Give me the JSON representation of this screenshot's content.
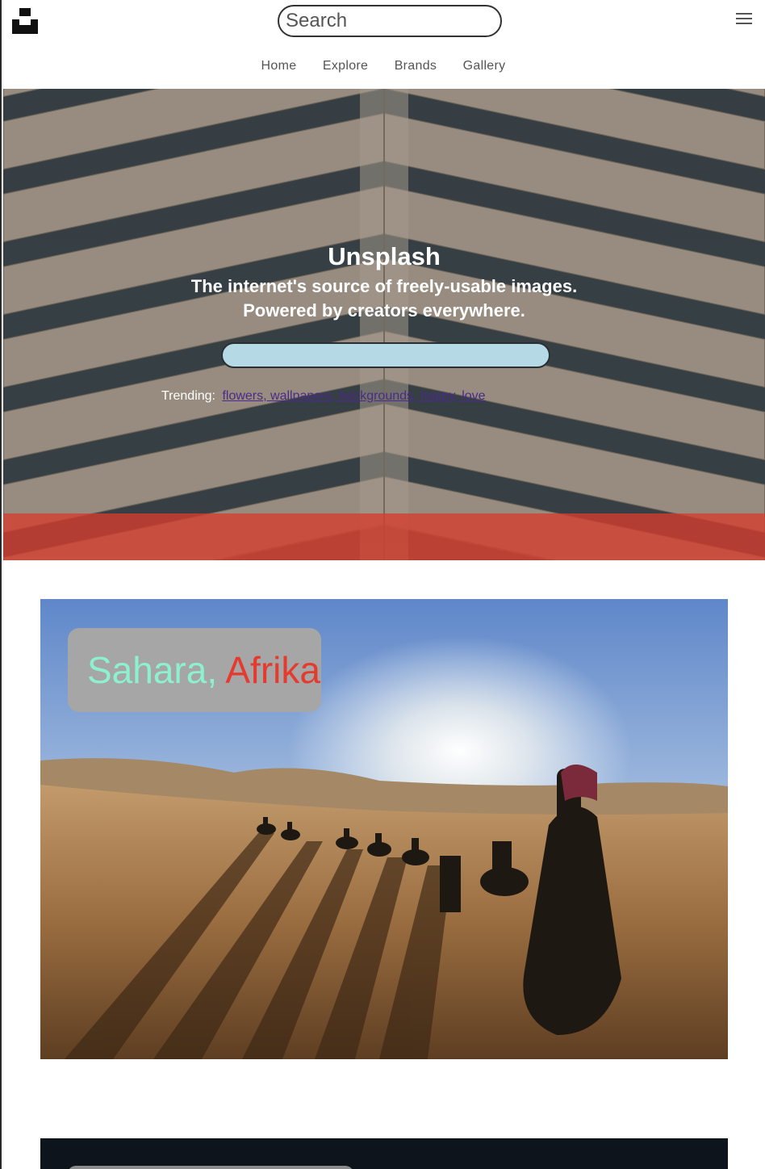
{
  "header": {
    "logo_icon": "unsplash-logo-icon",
    "search": {
      "placeholder": "Search",
      "value": ""
    },
    "menu_icon": "hamburger-menu-icon"
  },
  "nav": {
    "items": [
      {
        "label": "Home"
      },
      {
        "label": "Explore"
      },
      {
        "label": "Brands"
      },
      {
        "label": "Gallery"
      }
    ]
  },
  "hero": {
    "title": "Unsplash",
    "subtitle_line1": "The internet's source of freely-usable images.",
    "subtitle_line2": "Powered by creators everywhere.",
    "search": {
      "placeholder": "",
      "value": ""
    },
    "trending_label": "Trending:",
    "trending_links": "flowers, wallpapers, backgrounds, happy, love",
    "accent_color": "#d63c2d"
  },
  "cards": [
    {
      "label_part1": "Sahara,",
      "label_part2": "Afrika",
      "label_color1": "#8df0cf",
      "label_color2": "#e53b2e"
    }
  ]
}
